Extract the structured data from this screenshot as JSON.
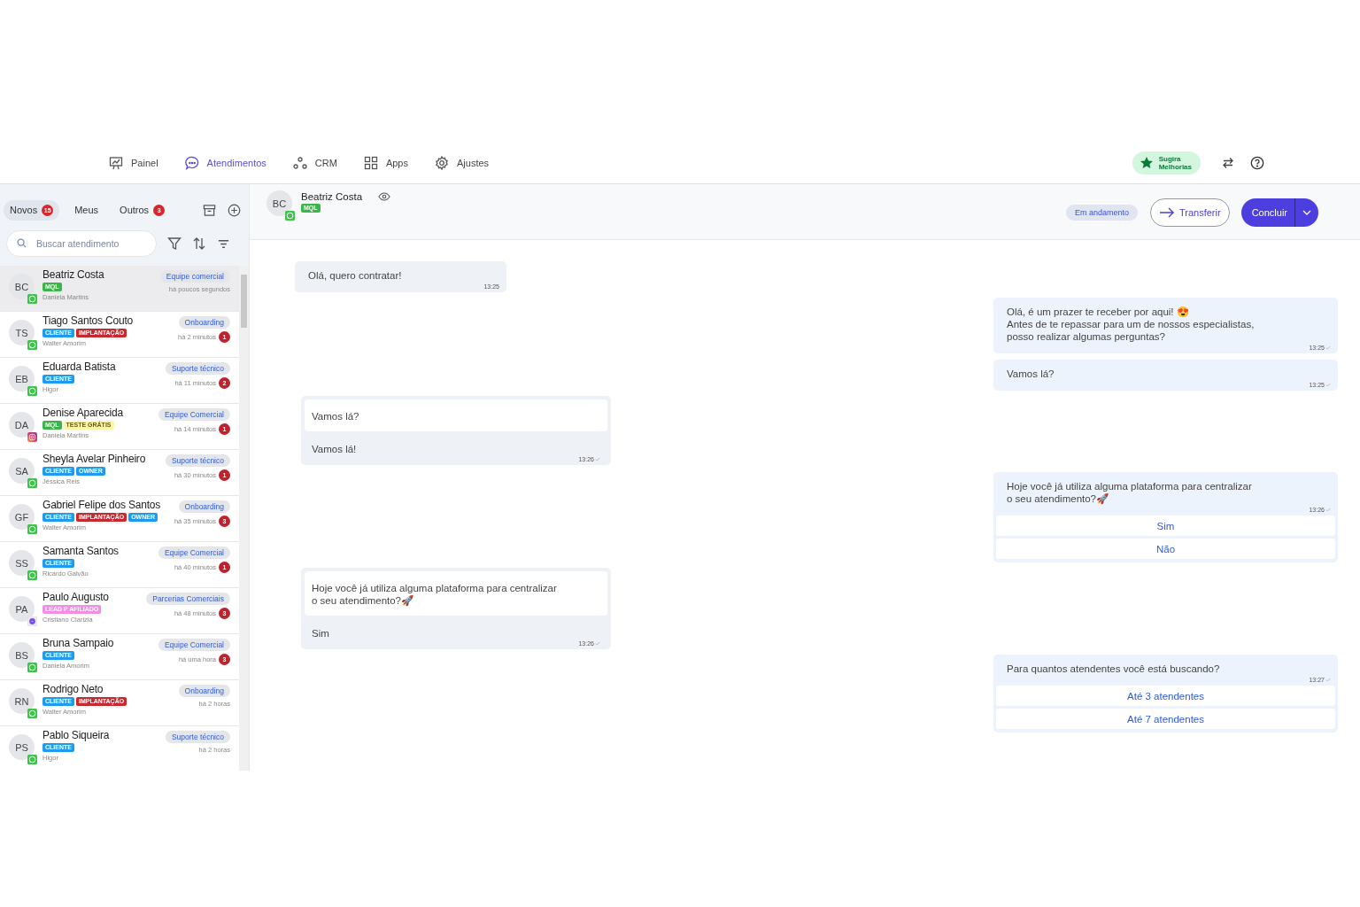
{
  "nav": [
    {
      "label": "Painel",
      "selected": false
    },
    {
      "label": "Atendimentos",
      "selected": true
    },
    {
      "label": "CRM",
      "selected": false
    },
    {
      "label": "Apps",
      "selected": false
    },
    {
      "label": "Ajustes",
      "selected": false
    }
  ],
  "suggest_button": {
    "line_1": "Sugira",
    "line_2": "Melhorias"
  },
  "tabs": [
    {
      "label": "Novos",
      "count": "15",
      "selected": true
    },
    {
      "label": "Meus",
      "selected": false
    },
    {
      "label": "Outros",
      "count": "3",
      "selected": false
    }
  ],
  "search": {
    "placeholder": "Buscar atendimento"
  },
  "contacts": [
    {
      "initials": "BC",
      "kind": "whatsapp",
      "name": "Beatriz Costa",
      "tags": [
        {
          "text": "MQL",
          "color": "#3bb54a"
        }
      ],
      "agent": "Daniela Martins",
      "team": "Equipe comercial",
      "time": "há poucos segundos",
      "selected": true
    },
    {
      "initials": "TS",
      "kind": "whatsapp",
      "name": "Tiago Santos Couto",
      "tags": [
        {
          "text": "CLIENTE",
          "color": "#1e9bf0"
        },
        {
          "text": "IMPLANTAÇÃO",
          "color": "#c62a2f"
        }
      ],
      "agent": "Walter Amorim",
      "team": "Onboarding",
      "time": "há 2 minutos",
      "unread": "1",
      "selected": false
    },
    {
      "initials": "EB",
      "kind": "whatsapp",
      "name": "Eduarda Batista",
      "tags": [
        {
          "text": "CLIENTE",
          "color": "#1e9bf0"
        }
      ],
      "agent": "Higor",
      "team": "Suporte técnico",
      "time": "há 11 minutos",
      "unread": "2",
      "selected": false
    },
    {
      "initials": "DA",
      "kind": "instagram",
      "name": "Denise Aparecida",
      "tags": [
        {
          "text": "MQL",
          "color": "#3bb54a"
        },
        {
          "text": "TESTE GRÁTIS",
          "color": "#fdf6a8"
        }
      ],
      "agent": "Daniela Martins",
      "team": "Equipe Comercial",
      "time": "há 14 minutos",
      "unread": "1",
      "selected": false
    },
    {
      "initials": "SA",
      "kind": "whatsapp",
      "name": "Sheyla Avelar Pinheiro",
      "tags": [
        {
          "text": "CLIENTE",
          "color": "#1e9bf0"
        },
        {
          "text": "OWNER",
          "color": "#1e9bf0"
        }
      ],
      "agent": "Jéssica Reis",
      "team": "Suporte técnico",
      "time": "há 30 minutos",
      "unread": "1",
      "selected": false
    },
    {
      "initials": "GF",
      "kind": "whatsapp",
      "name": "Gabriel Felipe dos Santos",
      "tags": [
        {
          "text": "CLIENTE",
          "color": "#1e9bf0"
        },
        {
          "text": "IMPLANTAÇÃO",
          "color": "#c62a2f"
        },
        {
          "text": "OWNER",
          "color": "#1e9bf0"
        }
      ],
      "agent": "Walter Amorim",
      "team": "Onboarding",
      "time": "há 35 minutos",
      "unread": "3",
      "selected": false
    },
    {
      "initials": "SS",
      "kind": "whatsapp",
      "name": "Samanta Santos",
      "tags": [
        {
          "text": "CLIENTE",
          "color": "#1e9bf0"
        }
      ],
      "agent": "Ricardo Galvão",
      "team": "Equipe Comercial",
      "time": "há 40 minutos",
      "unread": "1",
      "selected": false
    },
    {
      "initials": "PA",
      "kind": "messenger",
      "name": "Paulo Augusto",
      "tags": [
        {
          "text": "LEAD P AFILIADO",
          "color": "#f28ee6"
        }
      ],
      "agent": "Cristiano Clarizia",
      "team": "Parcerias Comerciais",
      "time": "há 48 minutos",
      "unread": "3",
      "selected": false
    },
    {
      "initials": "BS",
      "kind": "whatsapp",
      "name": "Bruna Sampaio",
      "tags": [
        {
          "text": "CLIENTE",
          "color": "#1e9bf0"
        }
      ],
      "agent": "Daniela Amorim",
      "team": "Equipe Comercial",
      "time": "há uma hora",
      "unread": "3",
      "selected": false
    },
    {
      "initials": "RN",
      "kind": "whatsapp",
      "name": "Rodrigo Neto",
      "tags": [
        {
          "text": "CLIENTE",
          "color": "#1e9bf0"
        },
        {
          "text": "IMPLANTAÇÃO",
          "color": "#c62a2f"
        }
      ],
      "agent": "Walter Amorim",
      "team": "Onboarding",
      "time": "há 2 horas",
      "selected": false
    },
    {
      "initials": "PS",
      "kind": "whatsapp",
      "name": "Pablo Siqueira",
      "tags": [
        {
          "text": "CLIENTE",
          "color": "#1e9bf0"
        }
      ],
      "agent": "Higor",
      "team": "Suporte técnico",
      "time": "há 2 horas",
      "selected": false
    }
  ],
  "chat_header": {
    "initials": "BC",
    "kind": "whatsapp",
    "name": "Beatriz Costa",
    "tags": [
      {
        "text": "MQL",
        "color": "#3bb54a"
      }
    ],
    "status": "Em andamento",
    "transfer": "Transferir",
    "finish": "Concluir"
  },
  "messages": [
    {
      "kind": "incoming",
      "text": "Olá, quero contratar!",
      "time": "13:25"
    },
    {
      "kind": "outgoing",
      "lines": [
        "Olá, é um prazer te receber por aqui! 😍",
        "Antes de te repassar para um de nossos especialistas,",
        "posso realizar algumas perguntas?"
      ],
      "time": "13:25"
    },
    {
      "kind": "outgoing",
      "lines": [
        "Vamos lá?"
      ],
      "time": "13:25"
    },
    {
      "kind": "reply",
      "quote": [
        "Vamos lá?"
      ],
      "text": "Vamos lá!",
      "time": "13:26"
    },
    {
      "kind": "outgoing",
      "lines": [
        "Hoje você já utiliza alguma plataforma para centralizar",
        "o seu atendimento?🚀"
      ],
      "time": "13:26",
      "options": [
        "Sim",
        "Não"
      ]
    },
    {
      "kind": "reply",
      "quote": [
        "Hoje você já utiliza alguma plataforma para centralizar",
        "o seu atendimento?🚀"
      ],
      "text": "Sim",
      "time": "13:26"
    },
    {
      "kind": "outgoing",
      "lines": [
        "Para quantos atendentes você está buscando?"
      ],
      "time": "13:27",
      "options": [
        "Até 3 atendentes",
        "Até 7 atendentes"
      ]
    }
  ]
}
